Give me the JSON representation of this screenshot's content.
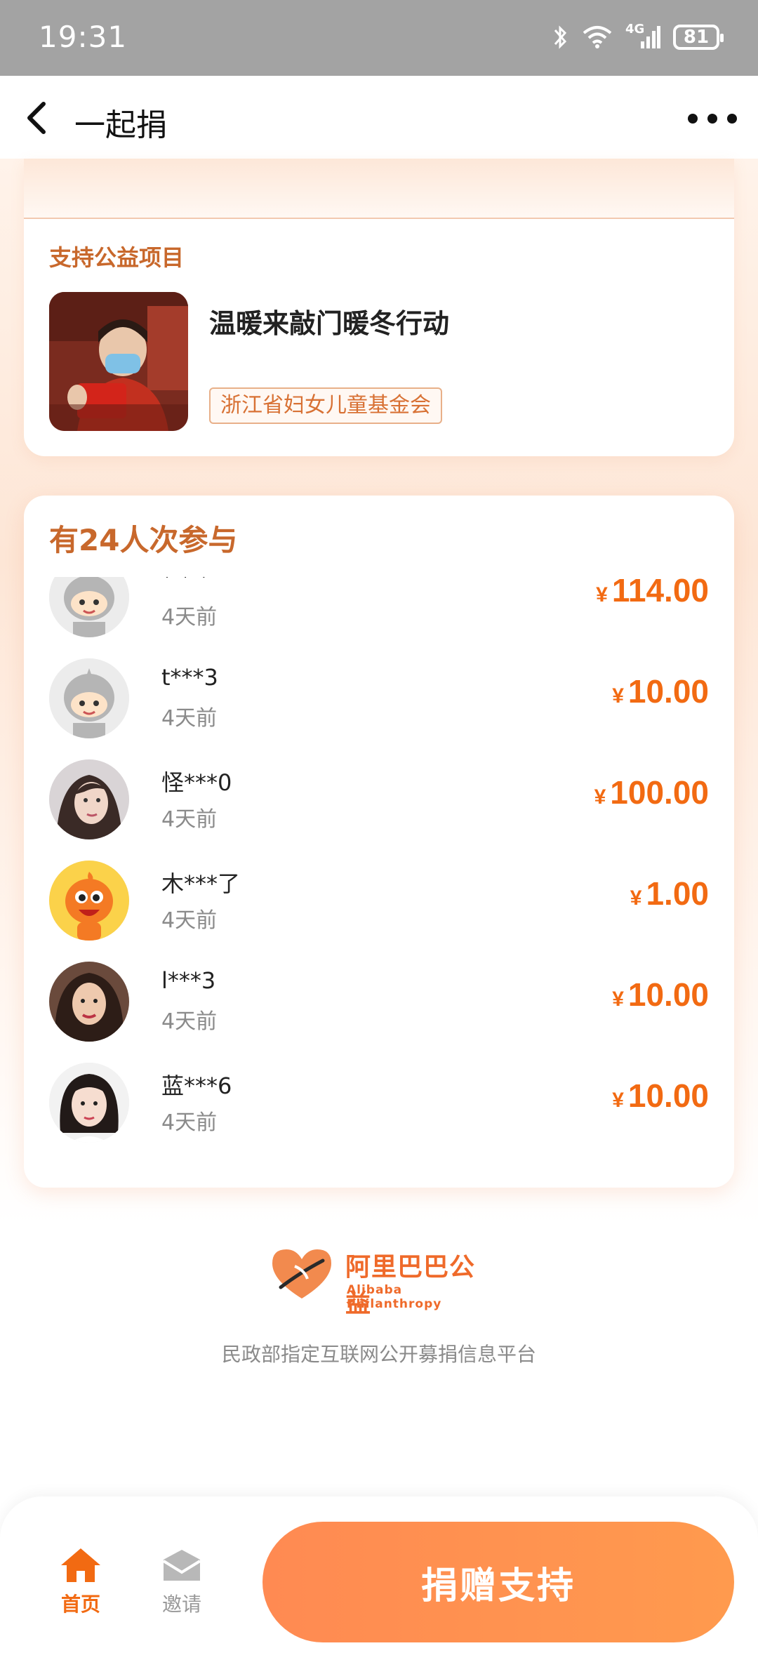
{
  "status_bar": {
    "time": "19:31",
    "signal": "4G",
    "battery": "81"
  },
  "nav": {
    "title": "一起捐"
  },
  "project_card": {
    "section_label": "支持公益项目",
    "project_title": "温暖来敲门暖冬行动",
    "organization": "浙江省妇女儿童基金会"
  },
  "participants": {
    "title": "有24人次参与",
    "currency_symbol": "¥",
    "donors": [
      {
        "name": "* * *",
        "time": "4天前",
        "amount": "114.00",
        "avatar": "robot-gray-avatar"
      },
      {
        "name": "t***3",
        "time": "4天前",
        "amount": "10.00",
        "avatar": "robot-gray-avatar"
      },
      {
        "name": "怪***0",
        "time": "4天前",
        "amount": "100.00",
        "avatar": "photo-avatar"
      },
      {
        "name": "木***了",
        "time": "4天前",
        "amount": "1.00",
        "avatar": "orange-mascot-avatar"
      },
      {
        "name": "l***3",
        "time": "4天前",
        "amount": "10.00",
        "avatar": "photo-avatar"
      },
      {
        "name": "蓝***6",
        "time": "4天前",
        "amount": "10.00",
        "avatar": "photo-avatar"
      }
    ]
  },
  "footer": {
    "logo_cn": "阿里巴巴公益",
    "logo_en": "Alibaba Philanthropy",
    "platform_note": "民政部指定互联网公开募捐信息平台"
  },
  "bottom_bar": {
    "home_label": "首页",
    "invite_label": "邀请",
    "donate_label": "捐赠支持"
  },
  "colors": {
    "accent": "#f26a12",
    "heading": "#c8682c",
    "button": "#ff8a52"
  }
}
